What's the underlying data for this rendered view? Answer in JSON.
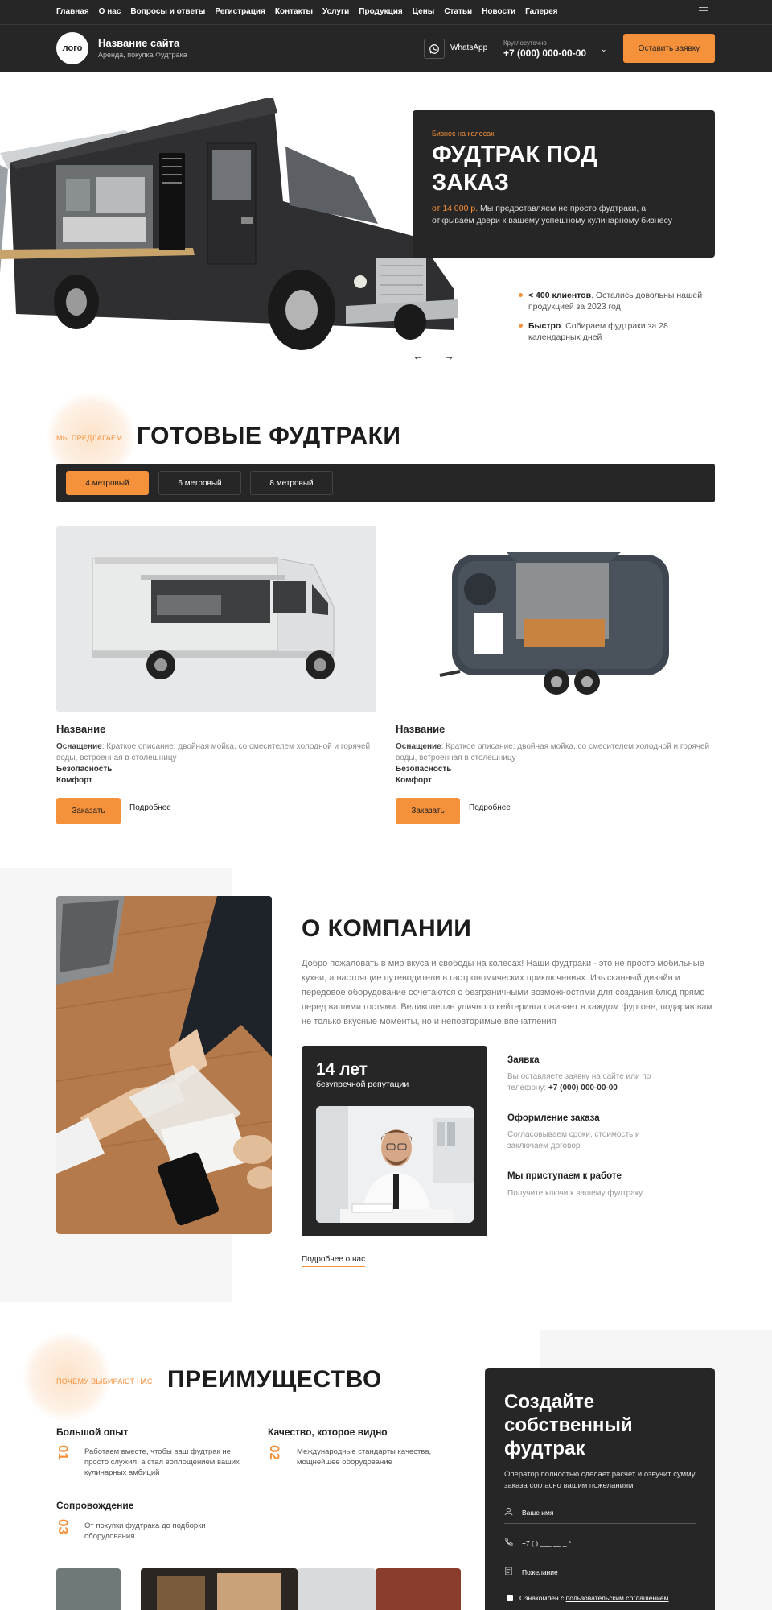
{
  "nav": {
    "links": [
      "Главная",
      "О нас",
      "Вопросы и ответы",
      "Регистрация",
      "Контакты",
      "Услуги",
      "Продукция",
      "Цены",
      "Статьи",
      "Новости",
      "Галерея"
    ]
  },
  "header": {
    "logo": "лого",
    "site_name": "Название сайта",
    "site_sub": "Аренда, покупка Фудтрака",
    "whatsapp": "WhatsApp",
    "hours": "Круглосуточно",
    "phone": "+7 (000) 000-00-00",
    "cta": "Оставить заявку"
  },
  "hero": {
    "kicker": "Бизнес на колесах",
    "title": "ФУДТРАК ПОД ЗАКАЗ",
    "price": "от 14 000 р.",
    "desc": "Мы предоставляем не просто фудтраки, а открываем двери к вашему успешному кулинарному бизнесу",
    "bullets": [
      {
        "bold": "< 400 клиентов",
        "text": ". Остались довольны нашей продукцией за 2023 год"
      },
      {
        "bold": "Быстро",
        "text": ". Собираем фудтраки за 28 календарных дней"
      }
    ]
  },
  "ready": {
    "kicker": "МЫ ПРЕДЛАГАЕМ",
    "title": "ГОТОВЫЕ ФУДТРАКИ",
    "tabs": [
      "4 метровый",
      "6 метровый",
      "8 метровый"
    ],
    "products": [
      {
        "title": "Название",
        "spec_label": "Оснащение",
        "spec": ": Краткое описание: двойная мойка, со смесителем холодной и горячей воды, встроенная в столешницу",
        "line1": "Безопасность",
        "line2": "Комфорт",
        "order": "Заказать",
        "more": "Подробнее"
      },
      {
        "title": "Название",
        "spec_label": "Оснащение",
        "spec": ": Краткое описание: двойная мойка, со смесителем холодной и горячей воды, встроенная в столешницу",
        "line1": "Безопасность",
        "line2": "Комфорт",
        "order": "Заказать",
        "more": "Подробнее"
      }
    ]
  },
  "about": {
    "title": "О КОМПАНИИ",
    "text": "Добро пожаловать в мир вкуса и свободы на колесах! Наши фудтраки - это не просто мобильные кухни, а настоящие путеводители в гастрономических приключениях. Изысканный дизайн и передовое оборудование сочетаются с безграничными возможностями для создания блюд прямо перед вашими гостями. Великолепие уличного кейтеринга оживает в каждом фургоне, подарив вам не только вкусные моменты, но и неповторимые впечатления",
    "years": "14 лет",
    "reputation": "безупречной репутации",
    "steps": [
      {
        "title": "Заявка",
        "desc": "Вы оставляете заявку на сайте или по телефону: ",
        "phone": "+7 (000) 000-00-00"
      },
      {
        "title": "Оформление заказа",
        "desc": "Согласовываем сроки, стоимость и заключаем договор"
      },
      {
        "title": "Мы приступаем к работе",
        "desc": "Получите ключи к вашему фудтраку"
      }
    ],
    "more": "Подробнее о нас"
  },
  "advantages": {
    "kicker": "ПОЧЕМУ ВЫБИРАЮТ НАС",
    "title": "ПРЕИМУЩЕСТВО",
    "items": [
      {
        "title": "Большой опыт",
        "num": "01",
        "desc": "Работаем вместе, чтобы ваш фудтрак не просто служил, а стал воплощением ваших кулинарных амбиций"
      },
      {
        "title": "Качество, которое видно",
        "num": "02",
        "desc": "Международные стандарты качества, мощнейшее оборудование"
      },
      {
        "title": "Сопровождение",
        "num": "03",
        "desc": "От покупки фудтрака до подборки оборудования"
      }
    ]
  },
  "form": {
    "title": "Создайте собственный фудтрак",
    "sub": "Оператор полностью сделает расчет и озвучит сумму заказа согласно вашим пожеланиям",
    "name_ph": "Ваше имя",
    "phone_ph": "+7 (   ) ___ __ _ *",
    "wish_ph": "Пожелание",
    "agree": "Ознакомлен с ",
    "agree_link": "пользовательским соглашением"
  },
  "colors": {
    "accent": "#f6913b",
    "dark": "#262626"
  }
}
